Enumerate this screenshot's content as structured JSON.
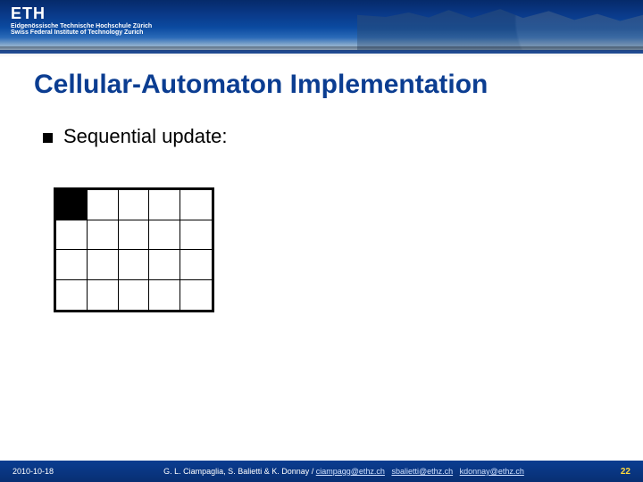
{
  "header": {
    "logo_text": "ETH",
    "inst_line1": "Eidgenössische Technische Hochschule Zürich",
    "inst_line2": "Swiss Federal Institute of Technology Zurich"
  },
  "title": "Cellular-Automaton Implementation",
  "bullet": {
    "text": "Sequential update:"
  },
  "grid": {
    "rows": 4,
    "cols": 5,
    "filled_cells": [
      [
        0,
        0
      ]
    ]
  },
  "footer": {
    "date": "2010-10-18",
    "credits_prefix": "G. L. Ciampaglia, S. Balietti & K. Donnay / ",
    "email1": "ciampagg@ethz.ch",
    "email2": "sbalietti@ethz.ch",
    "email3": "kdonnay@ethz.ch",
    "page_number": "22"
  }
}
